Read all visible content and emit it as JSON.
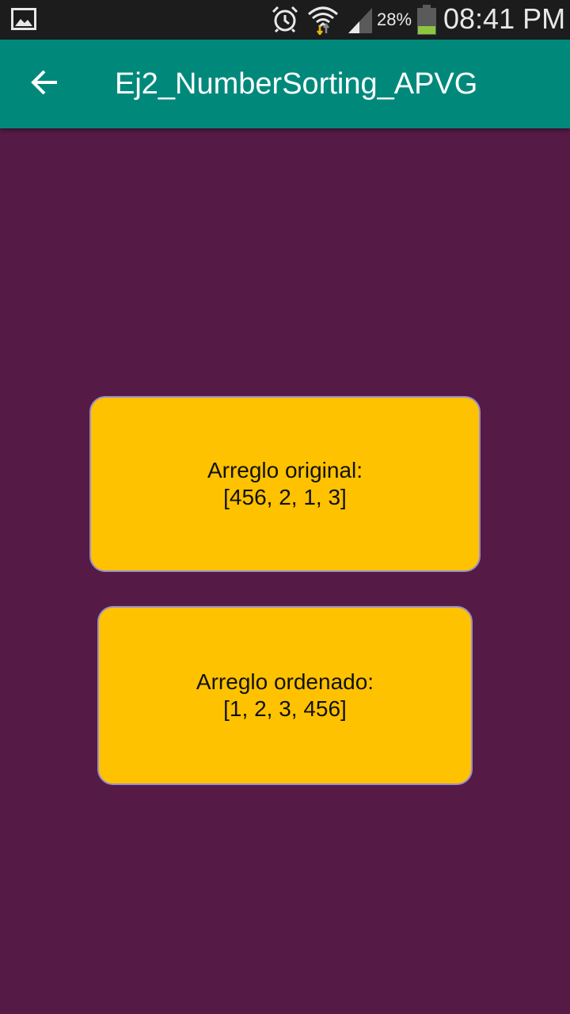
{
  "status_bar": {
    "battery_percent": "28%",
    "time": "08:41 PM",
    "icons": [
      "gallery-icon",
      "alarm-icon",
      "wifi-icon",
      "signal-icon",
      "battery-icon"
    ],
    "battery_color": "#8cc63f"
  },
  "app_bar": {
    "back_icon": "arrow-back-icon",
    "title": "Ej2_NumberSorting_APVG",
    "color": "#00897b"
  },
  "main": {
    "background_color": "#561a47",
    "card_color": "#ffc200",
    "original": {
      "label": "Arreglo original:",
      "value": "[456, 2, 1, 3]"
    },
    "sorted": {
      "label": "Arreglo ordenado:",
      "value": "[1, 2, 3, 456]"
    }
  }
}
